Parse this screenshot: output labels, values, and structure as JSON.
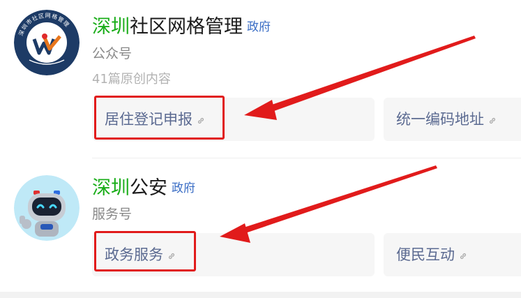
{
  "accounts": [
    {
      "name_highlight": "深圳",
      "name_rest": "社区网格管理",
      "tag": "政府",
      "type": "公众号",
      "count": "41篇原创内容",
      "avatar_ring_text": "深圳市社区网格管理",
      "menus": [
        "居住登记申报",
        "统一编码地址"
      ]
    },
    {
      "name_highlight": "深圳",
      "name_rest": "公安",
      "tag": "政府",
      "type": "服务号",
      "menus": [
        "政务服务",
        "便民互动"
      ]
    }
  ],
  "colors": {
    "highlight_green": "#1aad19",
    "tag_blue": "#3a6dc5",
    "menu_text": "#5b6a91",
    "annotation_red": "#e11b1b"
  },
  "icons": {
    "link": "link-icon",
    "arrow": "red-arrow-annotation"
  }
}
